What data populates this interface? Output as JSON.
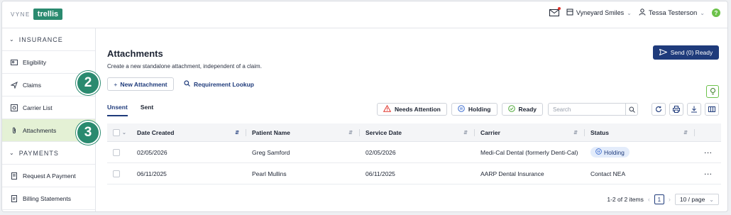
{
  "brand": {
    "vyne": "VYNE",
    "trellis": "trellis"
  },
  "topbar": {
    "practice": "Vyneyard Smiles",
    "user": "Tessa Testerson",
    "help": "?"
  },
  "sidebar": {
    "sections": [
      {
        "label": "INSURANCE",
        "items": [
          {
            "label": "Eligibility",
            "icon": "id-card-icon"
          },
          {
            "label": "Claims",
            "icon": "send-icon"
          },
          {
            "label": "Carrier List",
            "icon": "list-icon"
          },
          {
            "label": "Attachments",
            "icon": "paperclip-icon",
            "active": true
          }
        ]
      },
      {
        "label": "PAYMENTS",
        "items": [
          {
            "label": "Request A Payment",
            "icon": "receipt-icon"
          },
          {
            "label": "Billing Statements",
            "icon": "document-icon"
          }
        ]
      }
    ]
  },
  "page": {
    "title": "Attachments",
    "subtitle": "Create a new standalone attachment, independent of a claim.",
    "send_button": "Send (0) Ready",
    "new_attachment_button": "New Attachment",
    "requirement_lookup": "Requirement Lookup"
  },
  "tabs": [
    {
      "label": "Unsent",
      "active": true
    },
    {
      "label": "Sent",
      "active": false
    }
  ],
  "filters": {
    "needs_attention": "Needs Attention",
    "holding": "Holding",
    "ready": "Ready"
  },
  "search": {
    "placeholder": "Search"
  },
  "table": {
    "columns": [
      "Date Created",
      "Patient Name",
      "Service Date",
      "Carrier",
      "Status"
    ],
    "rows": [
      {
        "date_created": "02/05/2026",
        "patient": "Greg Samford",
        "service_date": "02/05/2026",
        "carrier": "Medi-Cal Dental (formerly Denti-Cal)",
        "status": "Holding"
      },
      {
        "date_created": "06/11/2025",
        "patient": "Pearl Mullins",
        "service_date": "06/11/2025",
        "carrier": "AARP Dental Insurance",
        "status": "Contact NEA"
      }
    ]
  },
  "pagination": {
    "summary": "1-2 of 2 items",
    "current_page": "1",
    "page_size": "10 / page"
  },
  "steps": [
    "2",
    "3"
  ],
  "colors": {
    "brand_green": "#2a8a6f",
    "primary_navy": "#1f3b7b",
    "active_nav": "#e4f1d5",
    "alert_red": "#e0342b"
  }
}
